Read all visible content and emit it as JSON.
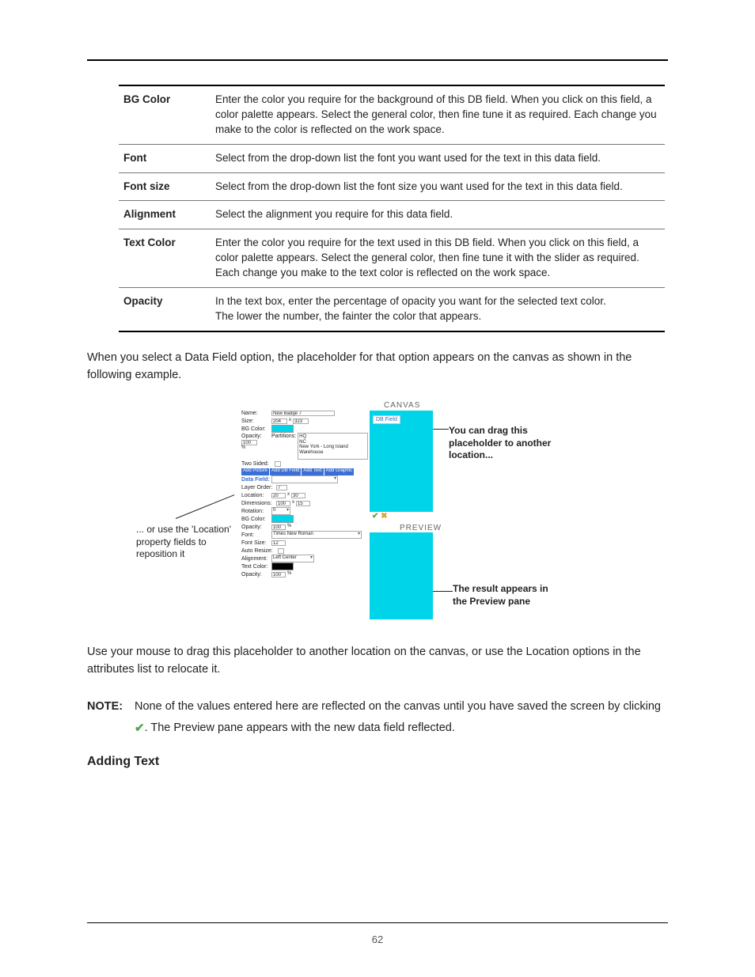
{
  "table_rows": [
    {
      "label": "BG Color",
      "desc": "Enter the color you require for the background of this DB field. When you click on this field, a color palette appears. Select the general color, then fine tune it as required. Each change you make to the color is reflected on the work space."
    },
    {
      "label": "Font",
      "desc": "Select from the drop-down list the font you want used for the text in this data field."
    },
    {
      "label": "Font size",
      "desc": "Select from the drop-down list the font size you want used for the text in this data field."
    },
    {
      "label": "Alignment",
      "desc": "Select the alignment you require for this data field."
    },
    {
      "label": "Text Color",
      "desc": "Enter the color you require for the text used in this DB field. When you click on this field, a color palette appears. Select the general color, then fine tune it with the slider as required. Each change you make to the text color is reflected on the work space."
    },
    {
      "label": "Opacity",
      "desc": "In the text box, enter the percentage of opacity you want for the selected text color.\nThe lower the number, the fainter the color that appears."
    }
  ],
  "para_intro": "When you select a Data Field option, the placeholder for that option appears on the canvas as shown in the following example.",
  "diagram": {
    "canvas_label": "CANVAS",
    "preview_label": "PREVIEW",
    "db_field_label": "DB Field",
    "callout_left": "... or use the 'Location' property fields to reposition it",
    "callout_tr": "You can drag this placeholder to another location...",
    "callout_br": "The result appears in the Preview pane",
    "panel": {
      "name_label": "Name:",
      "name_value": "New Badge 7",
      "size_label": "Size:",
      "size_w": "204",
      "size_h": "323",
      "bgcolor_label": "BG Color:",
      "opacity_label": "Opacity:",
      "opacity_value": "100",
      "partitions_label": "Partitions:",
      "partitions_items": "HQ\nNC\nNew York - Long Island Warehouse",
      "twosided_label": "Two Sided:",
      "btn_addpicture": "Add Picture",
      "btn_adddbfield": "Add DB Field",
      "btn_addtext": "Add Text",
      "btn_addgraphic": "Add Graphic",
      "datafield_label": "Data Field:",
      "layerorder_label": "Layer Order:",
      "layerorder_value": "7",
      "location_label": "Location:",
      "loc_x": "20",
      "loc_y": "30",
      "dimensions_label": "Dimensions:",
      "dim_w": "100",
      "dim_h": "15",
      "rotation_label": "Rotation:",
      "rotation_value": "0",
      "bgcolor2_label": "BG Color:",
      "opacity2_label": "Opacity:",
      "opacity2_value": "100",
      "opacity_pct": "%",
      "font_label": "Font:",
      "font_value": "Times New Roman",
      "fontsize_label": "Font Size:",
      "fontsize_value": "12",
      "autoresize_label": "Auto Resize:",
      "alignment_label": "Alignment:",
      "alignment_value": "Left Center",
      "textcolor_label": "Text Color:",
      "opacity3_label": "Opacity:",
      "opacity3_value": "100"
    }
  },
  "para_drag": "Use your mouse to drag this placeholder to another location on the canvas, or use the Location options in the attributes list to relocate it.",
  "note": {
    "label": "NOTE:",
    "text_before": "None of the values entered here are reflected on the canvas until you have saved the screen by clicking ",
    "text_after": ". The Preview pane appears with the new data field reflected."
  },
  "heading_adding_text": "Adding Text",
  "page_number": "62"
}
